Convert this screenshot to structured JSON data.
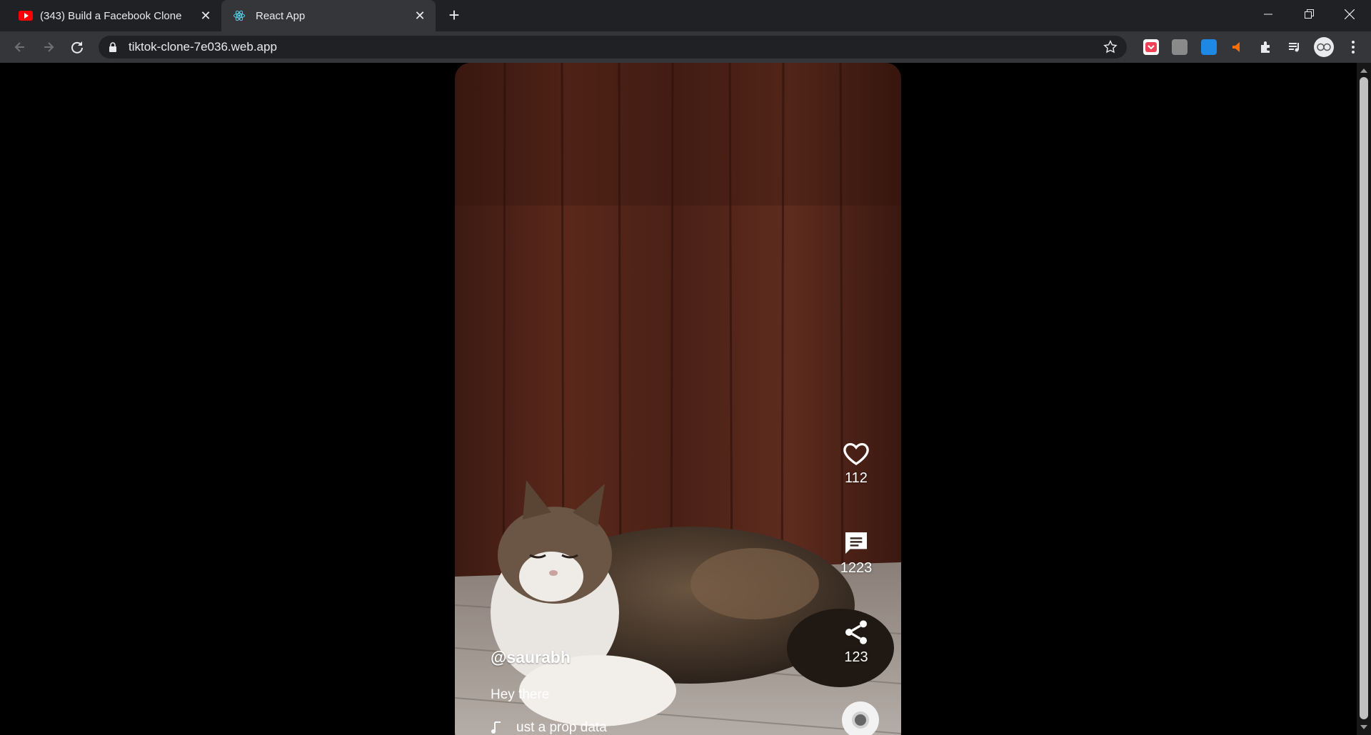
{
  "browser": {
    "tabs": [
      {
        "title": "(343)  Build a Facebook Clone",
        "active": false
      },
      {
        "title": "React App",
        "active": true
      }
    ],
    "url": "tiktok-clone-7e036.web.app"
  },
  "video": {
    "likes": "112",
    "comments": "1223",
    "shares": "123",
    "channel": "@saurabh",
    "description": "Hey there",
    "song": "ust a prop data"
  },
  "colors": {
    "tabstrip": "#202124",
    "toolbar": "#35363a",
    "page_bg": "#000000"
  }
}
